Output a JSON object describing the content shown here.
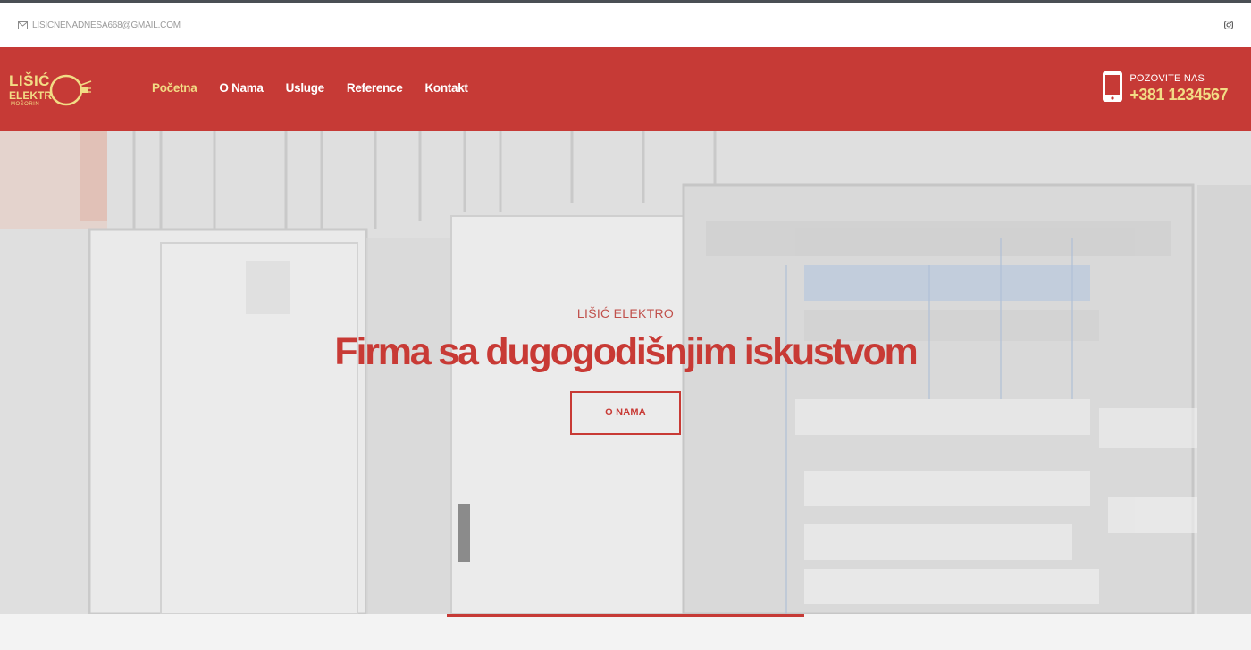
{
  "topbar": {
    "email": "LISICNENADNESA668@GMAIL.COM",
    "email_icon": "envelope-icon",
    "social_icon": "instagram-icon"
  },
  "logo": {
    "line1": "LIŠIĆ",
    "line2": "ELEKTR",
    "line3": "MOŠORIN"
  },
  "nav": {
    "items": [
      {
        "label": "Početna",
        "active": true
      },
      {
        "label": "O Nama",
        "active": false
      },
      {
        "label": "Usluge",
        "active": false
      },
      {
        "label": "Reference",
        "active": false
      },
      {
        "label": "Kontakt",
        "active": false
      }
    ]
  },
  "call": {
    "label": "POZOVITE NAS",
    "phone": "+381 1234567",
    "icon": "smartphone-icon"
  },
  "hero": {
    "kicker": "LIŠIĆ ELEKTRO",
    "headline": "Firma sa dugogodišnjim iskustvom",
    "button_label": "O NAMA"
  },
  "colors": {
    "brand_red": "#c63a36",
    "accent_yellow": "#f2dc85",
    "headline_red": "#c83a35"
  }
}
